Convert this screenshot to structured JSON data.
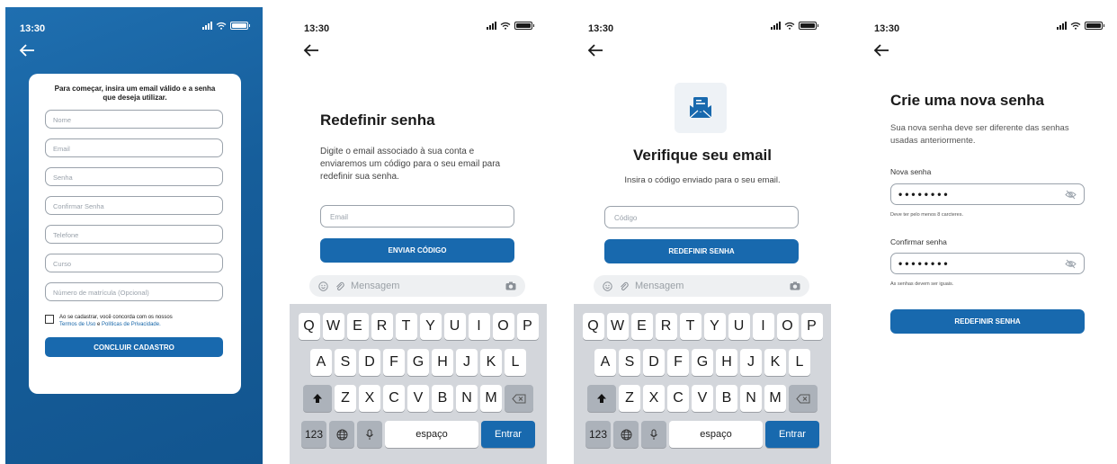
{
  "status": {
    "time": "13:30"
  },
  "screen1": {
    "intro": "Para começar, insira um email válido e a senha que deseja utilizar.",
    "fields": [
      "Nome",
      "Email",
      "Senha",
      "Confirmar Senha",
      "Telefone",
      "Curso",
      "Número de matrícula (Opcional)"
    ],
    "terms_prefix": "Ao se cadastrar, você concorda com os nossos",
    "terms_link": "Termos de Uso",
    "terms_and": "e",
    "privacy_link": "Políticas de Privacidade.",
    "button": "CONCLUIR CADASTRO"
  },
  "screen2": {
    "title": "Redefinir senha",
    "description": "Digite o email associado à sua conta e enviaremos um código para o seu email para redefinir sua senha.",
    "email_placeholder": "Email",
    "button": "ENVIAR CÓDIGO"
  },
  "screen3": {
    "title": "Verifique seu email",
    "description": "Insira o código enviado para o seu email.",
    "code_placeholder": "Código",
    "button": "REDEFINIR SENHA"
  },
  "screen4": {
    "title": "Crie uma nova senha",
    "description": "Sua nova senha deve ser diferente das senhas usadas anteriormente.",
    "new_label": "Nova senha",
    "new_value": "••••••••",
    "new_hint": "Deve ter pelo menos 8 carcteres.",
    "confirm_label": "Confirmar senha",
    "confirm_value": "••••••••",
    "confirm_hint": "As senhas devem ser iguais.",
    "button": "REDEFINIR SENHA"
  },
  "keyboard": {
    "message_placeholder": "Mensagem",
    "row1": [
      "Q",
      "W",
      "E",
      "R",
      "T",
      "Y",
      "U",
      "I",
      "O",
      "P"
    ],
    "row2": [
      "A",
      "S",
      "D",
      "F",
      "G",
      "H",
      "J",
      "K",
      "L"
    ],
    "row3": [
      "Z",
      "X",
      "C",
      "V",
      "B",
      "N",
      "M"
    ],
    "numbers": "123",
    "space": "espaço",
    "enter": "Entrar"
  },
  "colors": {
    "primary": "#1869ae",
    "background_blue": "#165e9b"
  }
}
